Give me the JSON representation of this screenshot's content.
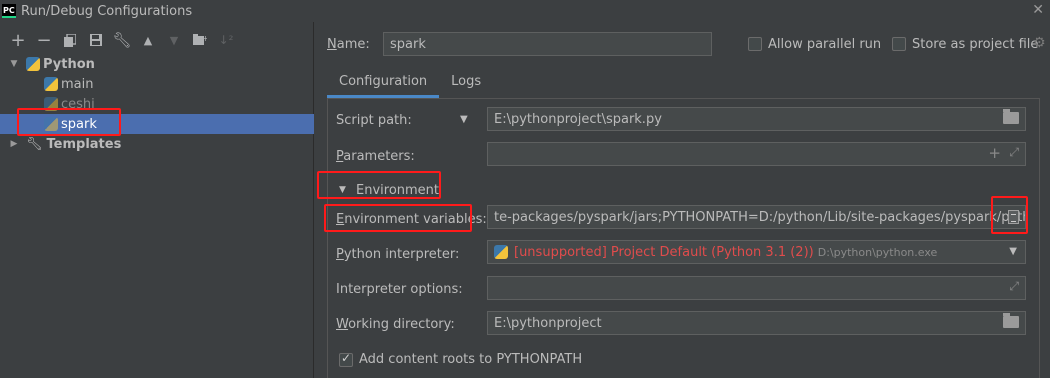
{
  "window": {
    "title": "Run/Debug Configurations",
    "logo": "PC"
  },
  "toolbar": {
    "buttons": [
      "add-icon",
      "remove-icon",
      "copy-icon",
      "save-icon",
      "wrench-icon",
      "move-up-icon",
      "move-down-icon",
      "new-folder-icon",
      "sort-icon"
    ]
  },
  "tree": {
    "python_label": "Python",
    "items": [
      "main",
      "ceshi",
      "spark"
    ],
    "templates_label": "Templates"
  },
  "header": {
    "name_label": "Name:",
    "name_value": "spark",
    "allow_parallel_label": "Allow parallel run",
    "store_as_file_label": "Store as project file"
  },
  "tabs": [
    "Configuration",
    "Logs"
  ],
  "config": {
    "script_path_label": "Script path:",
    "script_path_value": "E:\\pythonproject\\spark.py",
    "parameters_label": "Parameters:",
    "parameters_value": "",
    "environment_label": "Environment",
    "env_vars_label": "Environment variables:",
    "env_vars_value": "te-packages/pyspark/jars;PYTHONPATH=D:/python/Lib/site-packages/pyspark/python",
    "interpreter_label": "Python interpreter:",
    "interpreter_value": "[unsupported] Project Default (Python 3.1 (2))",
    "interpreter_path": "D:\\python\\python.exe",
    "interpreter_options_label": "Interpreter options:",
    "interpreter_options_value": "",
    "working_dir_label": "Working directory:",
    "working_dir_value": "E:\\pythonproject",
    "add_content_roots_label": "Add content roots to PYTHONPATH"
  },
  "colors": {
    "selection": "#4b6eaf",
    "highlight_box": "#ff1a1a",
    "unsupported_text": "#e04c4c",
    "tab_underline": "#4a88c7"
  }
}
